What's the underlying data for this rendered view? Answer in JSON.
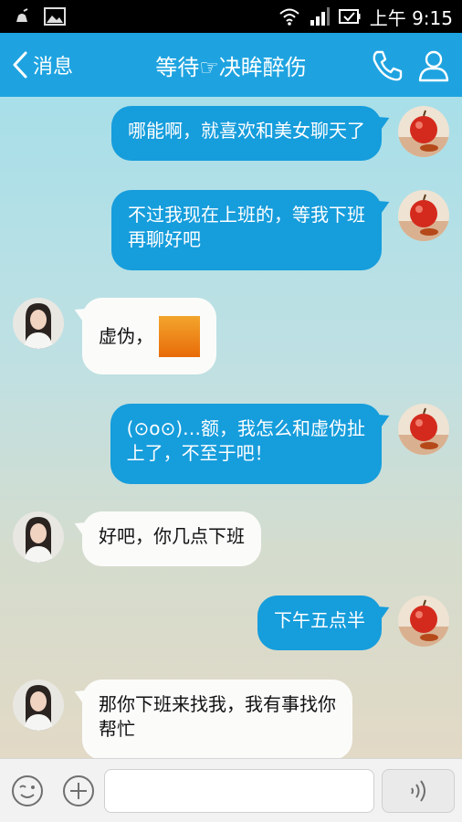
{
  "status_bar": {
    "time": "上午 9:15",
    "icons": [
      "notification-icon",
      "gallery-icon",
      "wifi-icon",
      "signal-icon",
      "battery-icon"
    ]
  },
  "header": {
    "back_label": "消息",
    "title": "等待☞决眸醉伤",
    "phone_icon": "phone-icon",
    "profile_icon": "profile-icon"
  },
  "messages": [
    {
      "side": "sent",
      "text": "哪能啊，就喜欢和美女聊天了"
    },
    {
      "side": "sent",
      "line1": "不过我现在上班的，等我下班",
      "line2": "再聊好吧"
    },
    {
      "side": "recv",
      "text": "虚伪，",
      "sticker": "orange-sticker"
    },
    {
      "side": "sent",
      "line1": "(⊙o⊙)…额，我怎么和虚伪扯",
      "line2": "上了，不至于吧！"
    },
    {
      "side": "recv",
      "text": "好吧，你几点下班"
    },
    {
      "side": "sent",
      "text": "下午五点半"
    },
    {
      "side": "recv",
      "line1": "那你下班来找我，我有事找你",
      "line2": "帮忙"
    }
  ],
  "input": {
    "placeholder": "",
    "emoji_icon": "emoji-icon",
    "plus_icon": "plus-icon",
    "voice_icon": "voice-icon"
  },
  "colors": {
    "accent": "#1ea3e0",
    "sent_bubble": "#169ddc",
    "recv_bubble": "#fbfcfa"
  }
}
